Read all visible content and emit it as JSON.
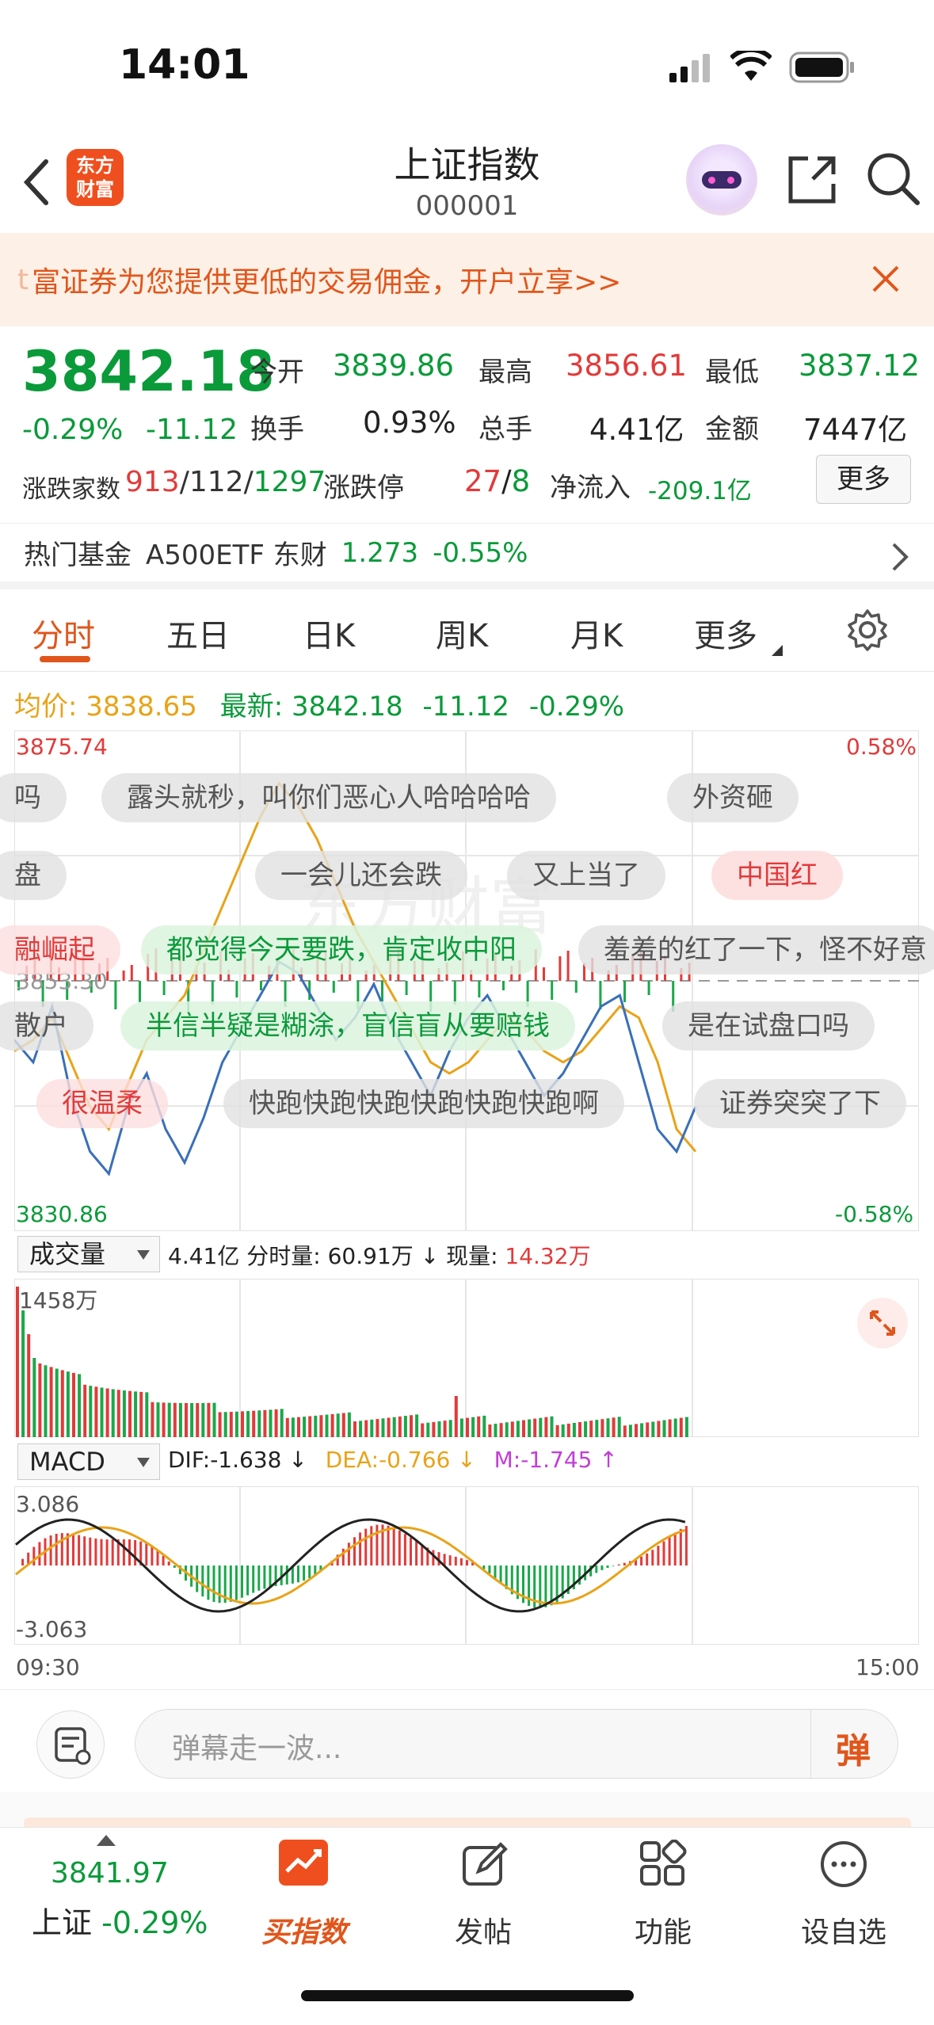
{
  "status_bar": {
    "time": "14:01"
  },
  "nav": {
    "title": "上证指数",
    "code": "000001",
    "logo_line1": "东方",
    "logo_line2": "财富"
  },
  "banner": {
    "text": "富证券为您提供更低的交易佣金，开户立享>>",
    "prefix": "t"
  },
  "quote": {
    "price": "3842.18",
    "pct": "-0.29%",
    "change": "-11.12",
    "open_label": "今开",
    "open": "3839.86",
    "high_label": "最高",
    "high": "3856.61",
    "low_label": "最低",
    "low": "3837.12",
    "turnover_label": "换手",
    "turnover": "0.93%",
    "volume_label": "总手",
    "volume": "4.41亿",
    "amount_label": "金额",
    "amount": "7447亿",
    "breadth_label": "涨跌家数",
    "breadth_up": "913",
    "breadth_flat": "112",
    "breadth_down": "1297",
    "limit_label": "涨跌停",
    "limit_up": "27",
    "limit_down": "8",
    "inflow_label": "净流入",
    "inflow": "-209.1亿",
    "more_button": "更多"
  },
  "fund": {
    "label": "热门基金",
    "name": "A500ETF 东财",
    "price": "1.273",
    "pct": "-0.55%"
  },
  "tabs": [
    "分时",
    "五日",
    "日K",
    "周K",
    "月K",
    "更多"
  ],
  "intraday": {
    "avg_label": "均价:",
    "avg": "3838.65",
    "last_label": "最新:",
    "last": "3842.18",
    "last_change": "-11.12",
    "last_pct": "-0.29%",
    "y_high": "3875.74",
    "y_mid": "3853.30",
    "y_low": "3830.86",
    "pct_high": "0.58%",
    "pct_low": "-0.58%",
    "watermark": "东方财富"
  },
  "danmu": [
    "吗",
    "露头就秒，叫你们恶心人哈哈哈哈",
    "外资砸",
    "盘",
    "一会儿还会跌",
    "又上当了",
    "中国红",
    "融崛起",
    "都觉得今天要跌，肯定收中阳",
    "羞羞的红了一下，怪不好意",
    "散户",
    "半信半疑是糊涂，盲信盲从要赔钱",
    "是在试盘口吗",
    "很温柔",
    "快跑快跑快跑快跑快跑快跑啊",
    "证券突突了下"
  ],
  "volume_panel": {
    "selector": "成交量",
    "total": "4.41亿",
    "period_label": "分时量:",
    "period": "60.91万",
    "arrow": "↓",
    "now_label": "现量:",
    "now": "14.32万",
    "max": "1458万"
  },
  "macd_panel": {
    "selector": "MACD",
    "dif_label": "DIF:",
    "dif": "-1.638",
    "dea_label": "DEA:",
    "dea": "-0.766",
    "m_label": "M:",
    "m": "-1.745",
    "up": "3.086",
    "down": "-3.063",
    "t_start": "09:30",
    "t_end": "15:00"
  },
  "input": {
    "placeholder": "弹幕走一波...",
    "send": "弹"
  },
  "tabbar": {
    "index_value": "3841.97",
    "index_label": "上证",
    "index_pct": "-0.29%",
    "buy": "买指数",
    "post": "发帖",
    "func": "功能",
    "watch": "设自选"
  },
  "chart_data": {
    "type": "line",
    "x_range": [
      "09:30",
      "15:00"
    ],
    "ylim": [
      3830.86,
      3875.74
    ],
    "series": [
      {
        "name": "最新",
        "color": "#3a6fb8",
        "values": [
          3848,
          3846,
          3851,
          3843,
          3838,
          3836,
          3842,
          3845,
          3840,
          3837,
          3841,
          3846,
          3849,
          3852,
          3855,
          3854,
          3851,
          3848,
          3850,
          3853,
          3849,
          3846,
          3843,
          3847,
          3850,
          3852,
          3849,
          3846,
          3843,
          3845,
          3848,
          3851,
          3852,
          3846,
          3840,
          3838,
          3842
        ]
      },
      {
        "name": "均价",
        "color": "#e8a318",
        "values": [
          3847,
          3848,
          3850,
          3846,
          3842,
          3840,
          3844,
          3848,
          3850,
          3852,
          3856,
          3860,
          3864,
          3868,
          3871,
          3869,
          3866,
          3862,
          3858,
          3855,
          3852,
          3849,
          3846,
          3845,
          3846,
          3848,
          3850,
          3849,
          3847,
          3846,
          3847,
          3849,
          3851,
          3850,
          3846,
          3840,
          3838
        ]
      }
    ]
  }
}
